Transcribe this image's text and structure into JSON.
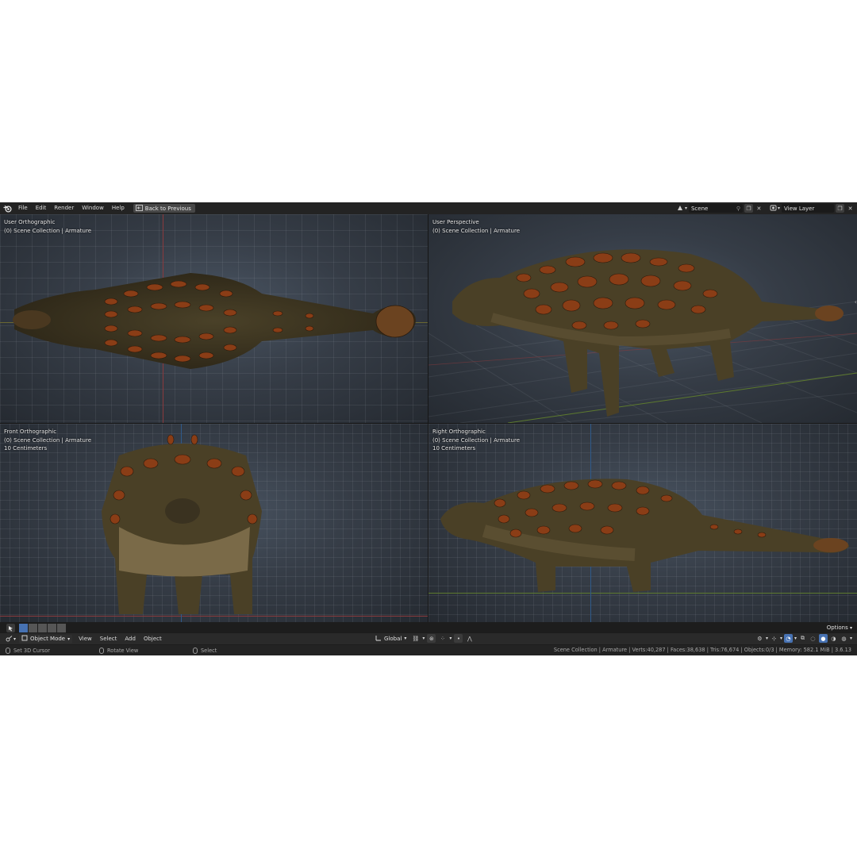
{
  "menu": {
    "items": [
      "File",
      "Edit",
      "Render",
      "Window",
      "Help"
    ],
    "back_label": "Back to Previous"
  },
  "topbar": {
    "scene_value": "Scene",
    "view_layer_value": "View Layer"
  },
  "viewports": [
    {
      "view": "User Orthographic",
      "collection": "(0) Scene Collection | Armature",
      "scale": ""
    },
    {
      "view": "User Perspective",
      "collection": "(0) Scene Collection | Armature",
      "scale": ""
    },
    {
      "view": "Front Orthographic",
      "collection": "(0) Scene Collection | Armature",
      "scale": "10 Centimeters"
    },
    {
      "view": "Right Orthographic",
      "collection": "(0) Scene Collection | Armature",
      "scale": "10 Centimeters"
    }
  ],
  "header": {
    "mode": "Object Mode",
    "menus": [
      "View",
      "Select",
      "Add",
      "Object"
    ],
    "transform_orientation": "Global",
    "options_label": "Options"
  },
  "status": {
    "hint_left": "Set 3D Cursor",
    "hint_middle": "Rotate View",
    "hint_right": "Select",
    "stats": "Scene Collection | Armature | Verts:40,287 | Faces:38,638 | Tris:76,674 | Objects:0/3 | Memory: 582.1 MiB | 3.6.13"
  },
  "icons": [
    "blender-logo-icon",
    "back-arrow-icon",
    "scene-icon",
    "pin-icon",
    "new-scene-icon",
    "close-icon",
    "view-layer-icon",
    "editor-type-icon",
    "object-mode-icon",
    "global-orientation-icon",
    "pivot-icon",
    "snap-icon",
    "proportional-icon",
    "gizmo-icon",
    "overlay-icon",
    "xray-icon",
    "shading-wireframe-icon",
    "shading-solid-icon",
    "shading-material-icon",
    "shading-rendered-icon",
    "mouse-icon"
  ],
  "colors": {
    "accent_blue": "#4772b3",
    "axis_x": "#8a3a3d",
    "axis_y": "#5d7a2e",
    "axis_z": "#2f5a8a"
  }
}
